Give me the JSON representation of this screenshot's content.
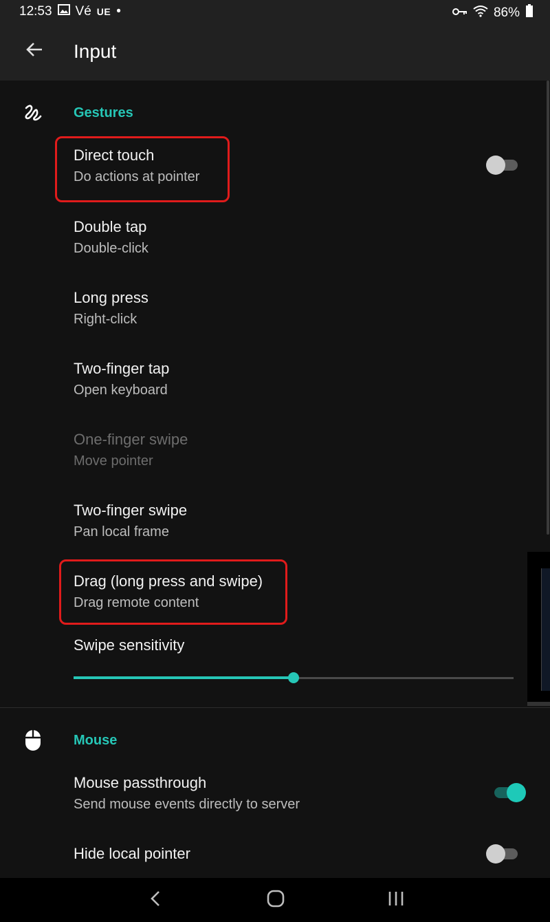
{
  "status_bar": {
    "time": "12:53",
    "carrier_1": "Vé",
    "carrier_2": "UE",
    "dot": "•",
    "battery": "86%",
    "icons": [
      "gallery-icon",
      "key-icon",
      "wifi-icon",
      "battery-icon"
    ]
  },
  "app_bar": {
    "title": "Input",
    "back_icon": "arrow-left-icon"
  },
  "gestures": {
    "header": "Gestures",
    "icon": "gesture-icon",
    "items": [
      {
        "title": "Direct touch",
        "subtitle": "Do actions at pointer",
        "toggle": false,
        "highlighted": true
      },
      {
        "title": "Double tap",
        "subtitle": "Double-click"
      },
      {
        "title": "Long press",
        "subtitle": "Right-click"
      },
      {
        "title": "Two-finger tap",
        "subtitle": "Open keyboard"
      },
      {
        "title": "One-finger swipe",
        "subtitle": "Move pointer",
        "disabled": true
      },
      {
        "title": "Two-finger swipe",
        "subtitle": "Pan local frame"
      },
      {
        "title": "Drag (long press and swipe)",
        "subtitle": "Drag remote content",
        "highlighted": true
      }
    ],
    "swipe_sensitivity": {
      "label": "Swipe sensitivity",
      "value": 0.5
    }
  },
  "mouse": {
    "header": "Mouse",
    "icon": "mouse-icon",
    "items": [
      {
        "title": "Mouse passthrough",
        "subtitle": "Send mouse events directly to server",
        "toggle": true
      },
      {
        "title": "Hide local pointer",
        "toggle": false
      }
    ]
  },
  "nav_bar": {
    "icons": [
      "back-icon",
      "home-icon",
      "recents-icon"
    ]
  },
  "colors": {
    "accent": "#26c6b6",
    "highlight": "#e01b1b",
    "background": "#121212",
    "appbar": "#212121"
  }
}
